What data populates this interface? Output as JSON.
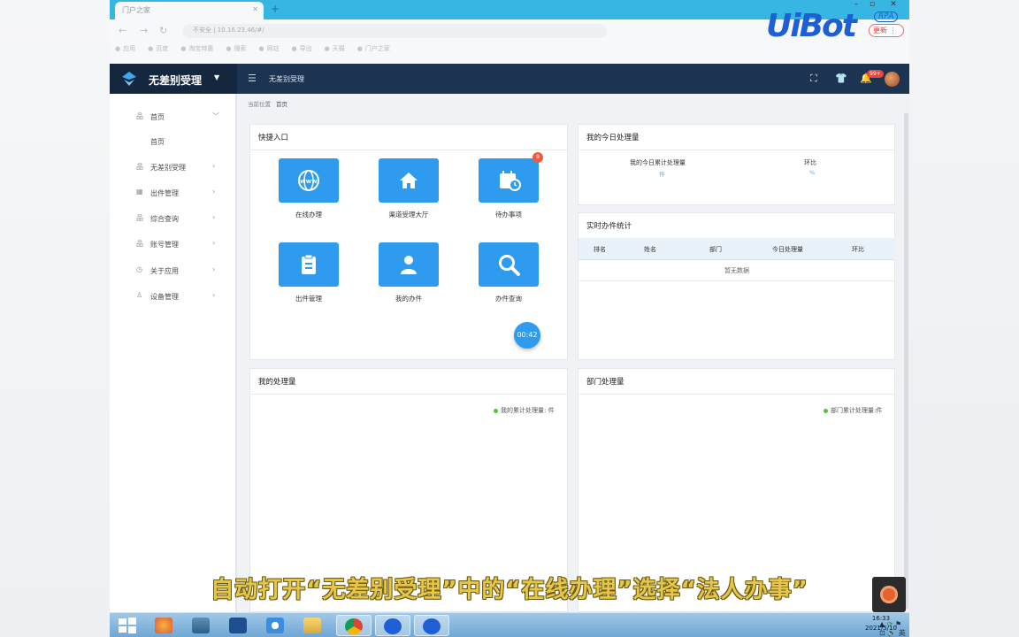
{
  "browser": {
    "tab_title": "门户之家",
    "address": "不安全 | 10.16.23.46/#/",
    "bookmarks": [
      "应用",
      "百度",
      "淘宝特惠",
      "搜索",
      "网站",
      "导出",
      "天猫",
      "门户之家"
    ]
  },
  "uibot": {
    "logo": "UiBot",
    "rpa": "RPA",
    "update": "更新"
  },
  "app": {
    "brand": "无差别受理",
    "header_title": "无差别受理",
    "notifications": "99+"
  },
  "sidebar": {
    "items": [
      {
        "label": "首页",
        "icon": "org-icon",
        "expanded": true
      },
      {
        "label": "首页",
        "sub": true
      },
      {
        "label": "无差别受理",
        "icon": "org-icon"
      },
      {
        "label": "出件管理",
        "icon": "grid-icon"
      },
      {
        "label": "综合查询",
        "icon": "org-icon"
      },
      {
        "label": "账号管理",
        "icon": "org-icon"
      },
      {
        "label": "关于应用",
        "icon": "clock-icon"
      },
      {
        "label": "设备管理",
        "icon": "user-icon"
      }
    ]
  },
  "breadcrumb": {
    "prefix": "当前位置",
    "current": "首页"
  },
  "quick_entry": {
    "title": "快捷入口",
    "tiles": [
      {
        "label": "在线办理",
        "icon": "www-globe-icon"
      },
      {
        "label": "渠道受理大厅",
        "icon": "home-icon"
      },
      {
        "label": "待办事项",
        "icon": "calendar-clock-icon",
        "badge": "9"
      },
      {
        "label": "出件管理",
        "icon": "clipboard-icon"
      },
      {
        "label": "我的办件",
        "icon": "person-icon"
      },
      {
        "label": "办件查询",
        "icon": "search-icon"
      }
    ],
    "timer": "00:42"
  },
  "today": {
    "title": "我的今日处理量",
    "metric_label": "我的今日累计处理量",
    "metric_unit": "件",
    "ratio_label": "环比",
    "ratio_unit": "%"
  },
  "realtime": {
    "title": "实时办件统计",
    "columns": [
      "排名",
      "姓名",
      "部门",
      "今日处理量",
      "环比"
    ],
    "empty": "暂无数据"
  },
  "my_volume": {
    "title": "我的处理量",
    "legend": "我的累计处理量: 件"
  },
  "dept_volume": {
    "title": "部门处理量",
    "legend": "部门累计处理量:件"
  },
  "caption": "自动打开“无差别受理”中的“在线办理”选择“法人办事”",
  "taskbar": {
    "time": "16:33",
    "date": "2021/5/10",
    "ime": "英"
  },
  "colors": {
    "header": "#1c3352",
    "tile": "#2f9bef",
    "caption": "#e6c64a"
  }
}
